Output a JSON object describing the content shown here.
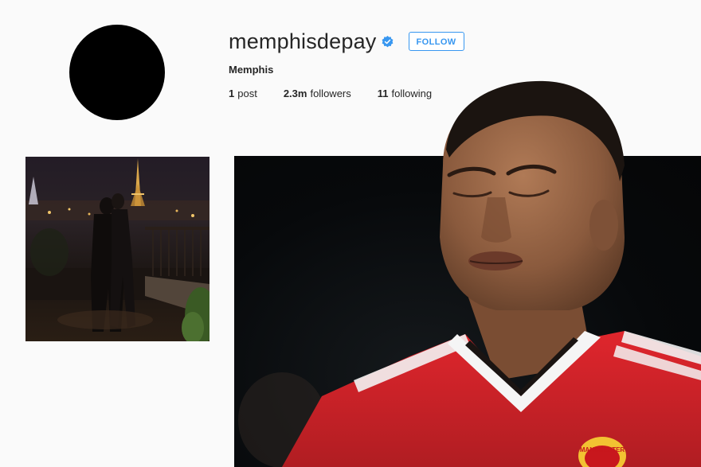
{
  "profile": {
    "username": "memphisdepay",
    "verified_icon": "verified-badge-icon",
    "follow_label": "FOLLOW",
    "full_name": "Memphis",
    "stats": {
      "posts_count": "1",
      "posts_label": "post",
      "followers_count": "2.3m",
      "followers_label": "followers",
      "following_count": "11",
      "following_label": "following"
    }
  },
  "colors": {
    "accent": "#3897f0",
    "text": "#262626",
    "background": "#fafafa",
    "jersey_red": "#d2232a"
  },
  "overlay": {
    "jersey_text": "MANCHESTER"
  }
}
